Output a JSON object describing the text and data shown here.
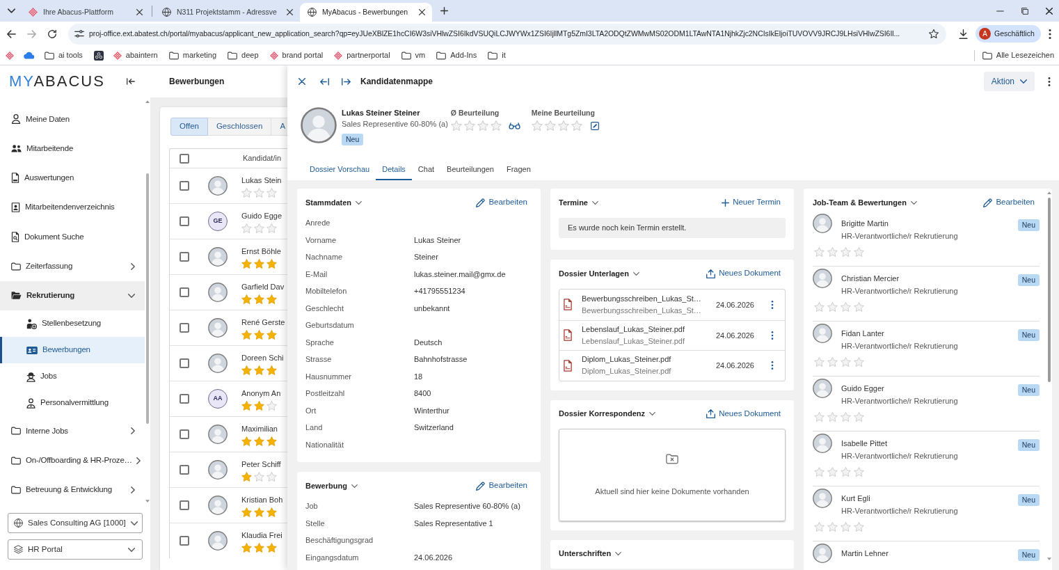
{
  "browser": {
    "tabs": [
      {
        "title": "Ihre Abacus-Plattform",
        "kind": "abacus",
        "selected": false
      },
      {
        "title": "N311 Projektstamm - Adressve",
        "kind": "globe",
        "selected": false
      },
      {
        "title": "MyAbacus - Bewerbungen",
        "kind": "globe",
        "selected": true
      }
    ],
    "url": "proj-office.ext.abatest.ch/portal/myabacus/applicant_new_application_search?qp=eyJUeXBlZE1hcCI6W3siVHlwZSI6IkdVSUQiLCJWYWx1ZSI6IjllMTg5ZmI3LTA2ODQtZWMwMS02ODM1LTAwNTA1NjhkZjc2NCIsIkEljoiTUVOVV9JRCJ9LHsiVHlwZSI6Il...",
    "profile": {
      "initial": "A",
      "label": "Geschäftlich"
    },
    "bookmarks": [
      {
        "kind": "abacus"
      },
      {
        "kind": "cloud"
      },
      {
        "kind": "folder",
        "label": "ai tools"
      },
      {
        "kind": "app"
      },
      {
        "kind": "abacus",
        "label": "abaintern"
      },
      {
        "kind": "folder",
        "label": "marketing"
      },
      {
        "kind": "folder",
        "label": "deep"
      },
      {
        "kind": "abacus",
        "label": "brand portal"
      },
      {
        "kind": "abacus",
        "label": "partnerportal"
      },
      {
        "kind": "folder",
        "label": "vm"
      },
      {
        "kind": "folder",
        "label": "Add-Ins"
      },
      {
        "kind": "folder",
        "label": "it"
      }
    ],
    "all_bookmarks": "Alle Lesezeichen"
  },
  "sidebar": {
    "logo": {
      "accent": "MY",
      "rest": "ABACUS"
    },
    "items": [
      {
        "label": "Meine Daten",
        "kind": "person",
        "selected": false
      },
      {
        "label": "Mitarbeitende",
        "kind": "people",
        "selected": false
      },
      {
        "label": "Auswertungen",
        "kind": "pdf",
        "selected": false
      },
      {
        "label": "Mitarbeitendenverzeichnis",
        "kind": "contact",
        "selected": false
      },
      {
        "label": "Dokument Suche",
        "kind": "search-doc",
        "selected": false
      },
      {
        "label": "Zeiterfassung",
        "kind": "folder",
        "selected": false,
        "expanded": false
      },
      {
        "label": "Rekrutierung",
        "kind": "folder",
        "selected": false,
        "expanded": true,
        "children": [
          {
            "label": "Stellenbesetzung",
            "kind": "person-add",
            "selected": false
          },
          {
            "label": "Bewerbungen",
            "kind": "id-card",
            "selected": true
          },
          {
            "label": "Jobs",
            "kind": "worker",
            "selected": false
          },
          {
            "label": "Personalvermittlung",
            "kind": "agent",
            "selected": false
          }
        ]
      },
      {
        "label": "Interne Jobs",
        "kind": "folder",
        "selected": false,
        "expanded": false
      },
      {
        "label": "On-/Offboarding & HR-Proze…",
        "kind": "folder",
        "selected": false,
        "expanded": false
      },
      {
        "label": "Betreuung & Entwicklung",
        "kind": "folder",
        "selected": false,
        "expanded": false
      }
    ],
    "selectors": [
      {
        "kind": "globe",
        "value": "Sales Consulting AG [1000]"
      },
      {
        "kind": "layers",
        "value": "HR Portal"
      }
    ]
  },
  "list": {
    "title": "Bewerbungen",
    "tabs": [
      {
        "label": "Offen",
        "selected": true
      },
      {
        "label": "Geschlossen",
        "selected": false
      },
      {
        "label": "A",
        "selected": false
      }
    ],
    "header": {
      "checked": false,
      "column": "Kandidat/in"
    },
    "rows": [
      {
        "name": "Lukas Stein",
        "kind": "photo",
        "stars": 0,
        "checked": false
      },
      {
        "name": "Guido Egge",
        "kind": "initials",
        "initials": "GE",
        "stars": 0,
        "checked": false
      },
      {
        "name": "Ernst Böhle",
        "kind": "photo",
        "stars": 3,
        "checked": false
      },
      {
        "name": "Garfield Dav",
        "kind": "photo",
        "stars": 3,
        "checked": false
      },
      {
        "name": "René Gerste",
        "kind": "photo",
        "stars": 3,
        "checked": false
      },
      {
        "name": "Doreen Schi",
        "kind": "photo",
        "stars": 3,
        "checked": false
      },
      {
        "name": "Anonym An",
        "kind": "initials",
        "initials": "AA",
        "stars": 2,
        "checked": false
      },
      {
        "name": "Maximilian",
        "kind": "photo",
        "stars": 3,
        "checked": false
      },
      {
        "name": "Peter Schiff",
        "kind": "photo",
        "stars": 1,
        "checked": false
      },
      {
        "name": "Kristian Boh",
        "kind": "photo",
        "stars": 3,
        "checked": false
      },
      {
        "name": "Klaudia Frei",
        "kind": "photo",
        "stars": 3,
        "checked": false
      }
    ]
  },
  "detail": {
    "title": "Kandidatenmappe",
    "action": "Aktion",
    "candidate": {
      "name": "Lukas Steiner Steiner",
      "job": "Sales Representive 60-80% (a)",
      "badge": "Neu"
    },
    "ratings": [
      {
        "kind": "average",
        "label": "Ø Beurteilung",
        "stars": 0
      },
      {
        "kind": "mine",
        "label": "Meine Beurteilung",
        "stars": 0
      }
    ],
    "tabs": [
      {
        "label": "Dossier Vorschau",
        "selected": false,
        "accent": true
      },
      {
        "label": "Details",
        "selected": true,
        "accent": true
      },
      {
        "label": "Chat",
        "selected": false,
        "accent": false
      },
      {
        "label": "Beurteilungen",
        "selected": false,
        "accent": false
      },
      {
        "label": "Fragen",
        "selected": false,
        "accent": false
      }
    ],
    "columns": [
      {
        "cards": [
          {
            "kind": "fields",
            "title": "Stammdaten",
            "action": "Bearbeiten",
            "fields": [
              {
                "label": "Anrede"
              },
              {
                "label": "Vorname",
                "value": "Lukas Steiner"
              },
              {
                "label": "Nachname",
                "value": "Steiner"
              },
              {
                "label": "E-Mail",
                "value": "lukas.steiner.mail@gmx.de"
              },
              {
                "label": "Mobiltelefon",
                "value": "+41795551234"
              },
              {
                "label": "Geschlecht",
                "value": "unbekannt"
              },
              {
                "label": "Geburtsdatum"
              },
              {
                "label": "Sprache",
                "value": "Deutsch"
              },
              {
                "label": "Strasse",
                "value": "Bahnhofstrasse"
              },
              {
                "label": "Hausnummer",
                "value": "18"
              },
              {
                "label": "Postleitzahl",
                "value": "8400"
              },
              {
                "label": "Ort",
                "value": "Winterthur"
              },
              {
                "label": "Land",
                "value": "Switzerland"
              },
              {
                "label": "Nationalität"
              }
            ]
          },
          {
            "kind": "fields",
            "title": "Bewerbung",
            "action": "Bearbeiten",
            "fields": [
              {
                "label": "Job",
                "value": "Sales Representive 60-80% (a)"
              },
              {
                "label": "Stelle",
                "value": "Sales Representative 1"
              },
              {
                "label": "Beschäftigungsgrad"
              },
              {
                "label": "Eingangsdatum",
                "value": "24.06.2026"
              }
            ]
          }
        ]
      },
      {
        "cards": [
          {
            "kind": "appointments",
            "title": "Termine",
            "action": "Neuer Termin",
            "message": "Es wurde noch kein Termin erstellt."
          },
          {
            "kind": "documents",
            "title": "Dossier Unterlagen",
            "action": "Neues Dokument",
            "documents": [
              {
                "name": "Bewerbungsschreiben_Lukas_St…",
                "file": "Bewerbungsschreiben_Lukas_St…",
                "date": "24.06.2026"
              },
              {
                "name": "Lebenslauf_Lukas_Steiner.pdf",
                "file": "Lebenslauf_Lukas_Steiner.pdf",
                "date": "24.06.2026"
              },
              {
                "name": "Diplom_Lukas_Steiner.pdf",
                "file": "Diplom_Lukas_Steiner.pdf",
                "date": "24.06.2026"
              }
            ]
          },
          {
            "kind": "empty_documents",
            "title": "Dossier Korrespondenz",
            "action": "Neues Dokument",
            "message": "Aktuell sind hier keine Dokumente vorhanden"
          },
          {
            "kind": "plain",
            "title": "Unterschriften"
          }
        ]
      },
      {
        "cards": [
          {
            "kind": "team",
            "title": "Job-Team & Bewertungen",
            "action": "Bearbeiten",
            "members": [
              {
                "name": "Brigitte Martin",
                "role": "HR-Verantwortliche/r Rekrutierung",
                "badge": "Neu",
                "stars": 0
              },
              {
                "name": "Christian Mercier",
                "role": "HR-Verantwortliche/r Rekrutierung",
                "badge": "Neu",
                "stars": 0
              },
              {
                "name": "Fidan Lanter",
                "role": "HR-Verantwortliche/r Rekrutierung",
                "badge": "Neu",
                "stars": 0
              },
              {
                "name": "Guido Egger",
                "role": "HR-Verantwortliche/r Rekrutierung",
                "badge": "Neu",
                "stars": 0
              },
              {
                "name": "Isabelle Pittet",
                "role": "HR-Verantwortliche/r Rekrutierung",
                "badge": "Neu",
                "stars": 0
              },
              {
                "name": "Kurt Egli",
                "role": "HR-Verantwortliche/r Rekrutierung",
                "badge": "Neu",
                "stars": 0
              },
              {
                "name": "Martin Lehner",
                "badge": "Neu"
              }
            ]
          }
        ]
      }
    ]
  }
}
